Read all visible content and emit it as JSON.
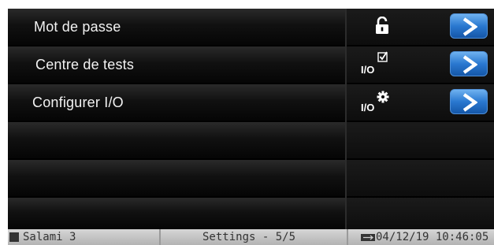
{
  "menu": {
    "items": [
      {
        "label": "Mot de passe",
        "icon": "lock-icon",
        "io_text": ""
      },
      {
        "label": "Centre de tests",
        "icon": "checkbox-icon",
        "io_text": "I/O"
      },
      {
        "label": "Configurer I/O",
        "icon": "gear-icon",
        "io_text": "I/O"
      }
    ],
    "arrow_icon": "chevron-right-icon"
  },
  "status_bar": {
    "device_name": "Salami 3",
    "page": "Settings - 5/5",
    "usb_icon": "usb-icon",
    "datetime": "04/12/19 10:46:05"
  },
  "colors": {
    "accent_button": "#2a78d0",
    "status_bar_bg": "#c4c4c4",
    "screen_bg": "#000000"
  }
}
